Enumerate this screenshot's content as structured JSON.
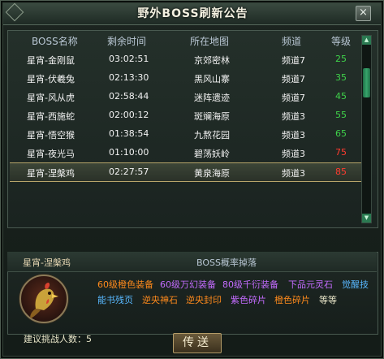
{
  "window": {
    "title": "野外BOSS刷新公告",
    "close_label": "×"
  },
  "table": {
    "headers": [
      "BOSS名称",
      "剩余时间",
      "所在地图",
      "频道",
      "等级"
    ],
    "rows": [
      {
        "name": "星宵-金刚鼠",
        "time": "03:02:51",
        "map": "京郊密林",
        "channel": "频道7",
        "level": "25",
        "level_color": "#3fd24a"
      },
      {
        "name": "星宵-伏羲兔",
        "time": "02:13:30",
        "map": "黑风山寨",
        "channel": "频道7",
        "level": "35",
        "level_color": "#3fd24a"
      },
      {
        "name": "星宵-风从虎",
        "time": "02:58:44",
        "map": "迷阵遗迹",
        "channel": "频道7",
        "level": "45",
        "level_color": "#3fd24a"
      },
      {
        "name": "星宵-西施蛇",
        "time": "02:00:12",
        "map": "斑斓海原",
        "channel": "频道3",
        "level": "55",
        "level_color": "#3fd24a"
      },
      {
        "name": "星宵-悟空猴",
        "time": "01:38:54",
        "map": "九熬花园",
        "channel": "频道3",
        "level": "65",
        "level_color": "#3fd24a"
      },
      {
        "name": "星宵-夜光马",
        "time": "01:10:00",
        "map": "碧荡妖岭",
        "channel": "频道3",
        "level": "75",
        "level_color": "#ff3b2f"
      },
      {
        "name": "星宵-涅槃鸡",
        "time": "02:27:57",
        "map": "黄泉海原",
        "channel": "频道3",
        "level": "85",
        "level_color": "#ff3b2f"
      }
    ],
    "selected_index": 6
  },
  "detail": {
    "boss_name": "星宵-涅槃鸡",
    "drops_title": "BOSS概率掉落",
    "drops": [
      {
        "text": "60级橙色装备",
        "color": "#ff8a1c"
      },
      {
        "text": "60级万幻装备",
        "color": "#c46cff"
      },
      {
        "text": "80级千衍装备",
        "color": "#c46cff"
      },
      {
        "text": "下品元灵石",
        "color": "#c46cff"
      },
      {
        "text": "觉醒技",
        "color": "#58b8ff"
      },
      {
        "text": "能书残页",
        "color": "#58b8ff"
      },
      {
        "text": "逆央神石",
        "color": "#ff8a1c"
      },
      {
        "text": "逆央封印",
        "color": "#ff8a1c"
      },
      {
        "text": "紫色碎片",
        "color": "#c46cff"
      },
      {
        "text": "橙色碎片",
        "color": "#ff8a1c"
      },
      {
        "text": "等等",
        "color": "#e9e6c9"
      }
    ]
  },
  "footer": {
    "challengers_label": "建议挑战人数：5",
    "send_button": "传送"
  }
}
